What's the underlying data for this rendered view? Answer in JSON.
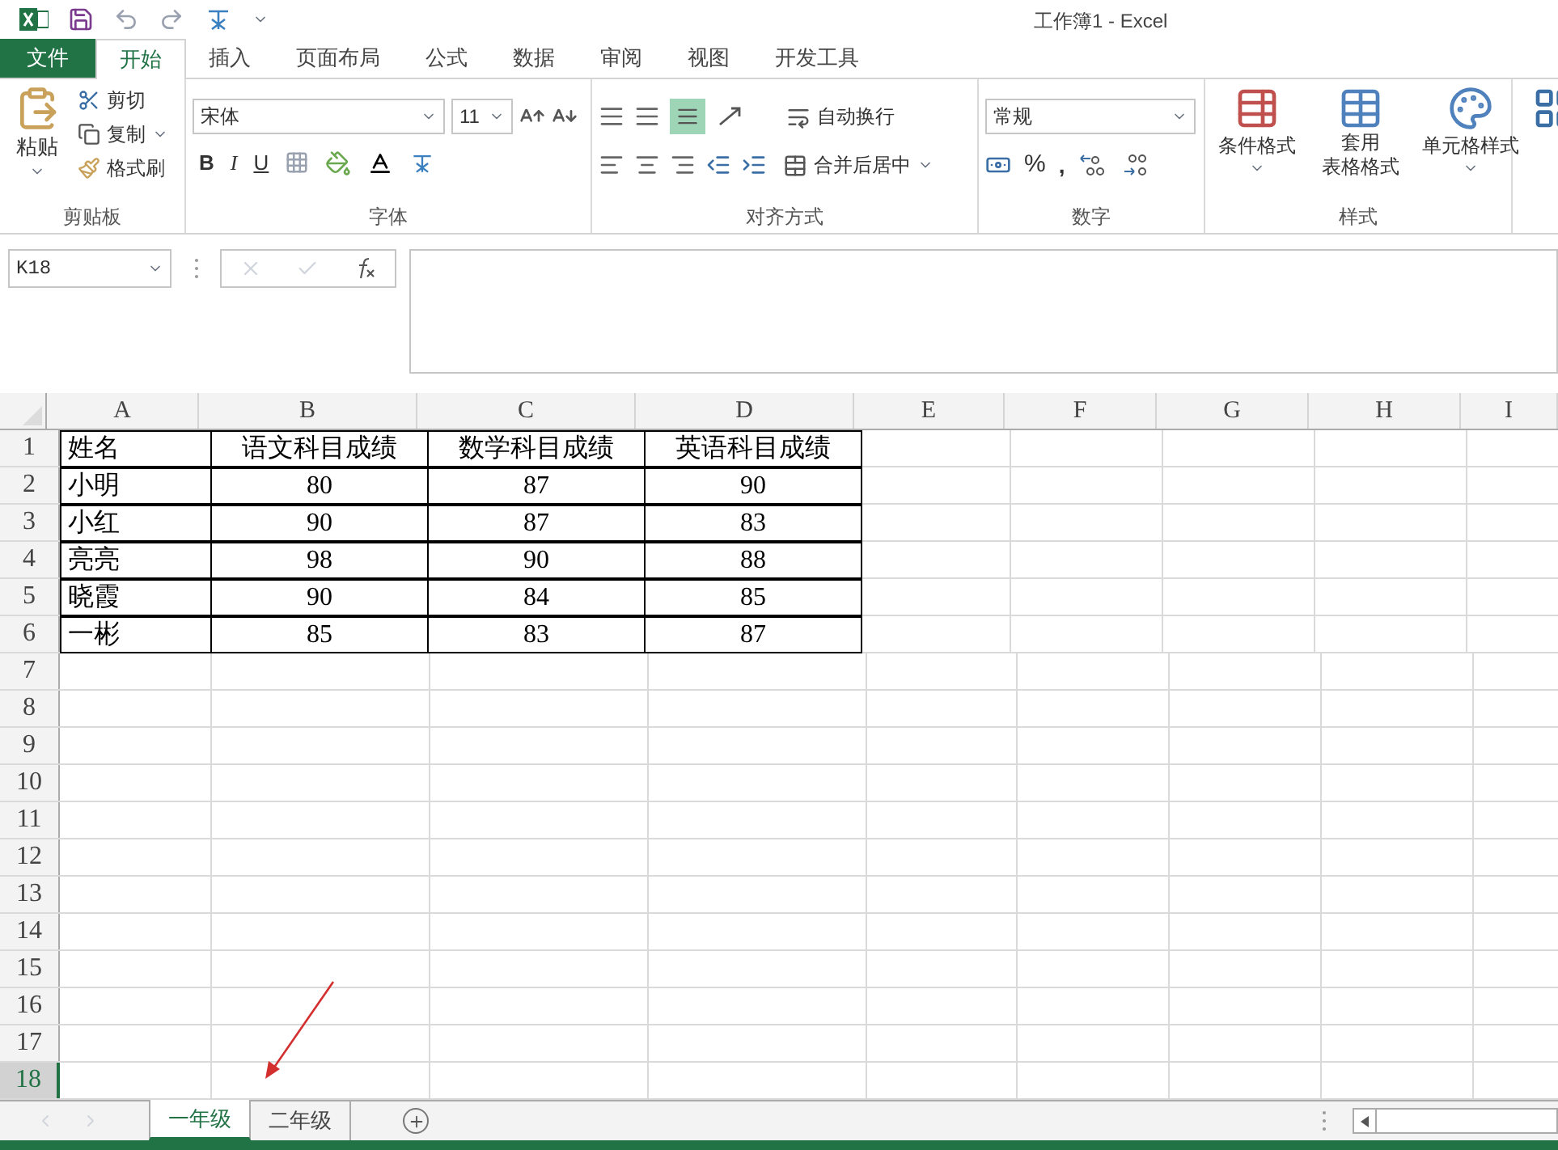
{
  "window": {
    "title": "工作簿1 - Excel"
  },
  "file_tab": "文件",
  "tabs": [
    {
      "label": "开始",
      "selected": true
    },
    {
      "label": "插入",
      "selected": false
    },
    {
      "label": "页面布局",
      "selected": false
    },
    {
      "label": "公式",
      "selected": false
    },
    {
      "label": "数据",
      "selected": false
    },
    {
      "label": "审阅",
      "selected": false
    },
    {
      "label": "视图",
      "selected": false
    },
    {
      "label": "开发工具",
      "selected": false
    }
  ],
  "ribbon": {
    "clipboard": {
      "label": "剪贴板",
      "paste": "粘贴",
      "cut": "剪切",
      "copy": "复制",
      "format_painter": "格式刷"
    },
    "font": {
      "label": "字体",
      "font_name": "宋体",
      "font_size": "11",
      "bold": "B",
      "italic": "I",
      "underline": "U"
    },
    "alignment": {
      "label": "对齐方式",
      "wrap_text": "自动换行",
      "merge_center": "合并后居中"
    },
    "number": {
      "label": "数字",
      "format": "常规",
      "percent": "%",
      "comma": ","
    },
    "styles": {
      "label": "样式",
      "conditional_formatting": "条件格式",
      "format_as_table": [
        "套用",
        "表格格式"
      ],
      "cell_styles": "单元格样式"
    }
  },
  "formula_bar": {
    "name_box": "K18"
  },
  "sheet": {
    "columns": [
      "A",
      "B",
      "C",
      "D",
      "E",
      "F",
      "G",
      "H",
      "I"
    ],
    "rows": [
      {
        "number": "1",
        "selected": false,
        "cells": [
          "姓名",
          "语文科目成绩",
          "数学科目成绩",
          "英语科目成绩"
        ]
      },
      {
        "number": "2",
        "selected": false,
        "cells": [
          "小明",
          "80",
          "87",
          "90"
        ]
      },
      {
        "number": "3",
        "selected": false,
        "cells": [
          "小红",
          "90",
          "87",
          "83"
        ]
      },
      {
        "number": "4",
        "selected": false,
        "cells": [
          "亮亮",
          "98",
          "90",
          "88"
        ]
      },
      {
        "number": "5",
        "selected": false,
        "cells": [
          "晓霞",
          "90",
          "84",
          "85"
        ]
      },
      {
        "number": "6",
        "selected": false,
        "cells": [
          "一彬",
          "85",
          "83",
          "87"
        ]
      },
      {
        "number": "7",
        "selected": false
      },
      {
        "number": "8",
        "selected": false
      },
      {
        "number": "9",
        "selected": false
      },
      {
        "number": "10",
        "selected": false
      },
      {
        "number": "11",
        "selected": false
      },
      {
        "number": "12",
        "selected": false
      },
      {
        "number": "13",
        "selected": false
      },
      {
        "number": "14",
        "selected": false
      },
      {
        "number": "15",
        "selected": false
      },
      {
        "number": "16",
        "selected": false
      },
      {
        "number": "17",
        "selected": false
      },
      {
        "number": "18",
        "selected": true
      }
    ]
  },
  "sheet_tabs": [
    {
      "label": "一年级",
      "selected": true
    },
    {
      "label": "二年级",
      "selected": false
    }
  ]
}
